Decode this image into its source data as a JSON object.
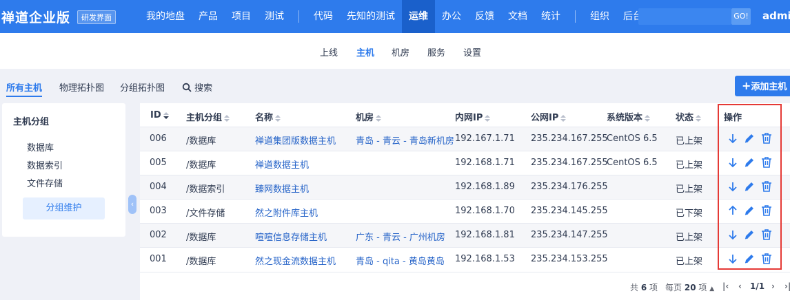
{
  "topbar": {
    "brand": "禅道企业版",
    "edition_badge": "研发界面",
    "nav": [
      "我的地盘",
      "产品",
      "项目",
      "测试",
      "代码",
      "先知的测试",
      "运维",
      "办公",
      "反馈",
      "文档",
      "统计",
      "组织",
      "后台"
    ],
    "active_nav": "运维",
    "go_label": "GO!",
    "user": "admin"
  },
  "subnav": {
    "items": [
      "上线",
      "主机",
      "机房",
      "服务",
      "设置"
    ],
    "active": "主机"
  },
  "toolbar": {
    "tabs": [
      "所有主机",
      "物理拓扑图",
      "分组拓扑图"
    ],
    "search_label": "搜索",
    "add_button": "添加主机"
  },
  "side": {
    "title": "主机分组",
    "items": [
      "数据库",
      "数据索引",
      "文件存储"
    ],
    "button": "分组维护"
  },
  "table": {
    "headers": [
      "ID",
      "主机分组",
      "名称",
      "机房",
      "内网IP",
      "公网IP",
      "系统版本",
      "状态",
      "操作"
    ],
    "rows": [
      {
        "id": "006",
        "group": "/数据库",
        "name": "禅道集团版数据主机",
        "room": "青岛 - 青云 - 青岛新机房",
        "intranet": "192.167.1.71",
        "public": "235.234.167.255",
        "os": "CentOS 6.5",
        "status": "已上架",
        "action": "down"
      },
      {
        "id": "005",
        "group": "/数据库",
        "name": "禅道数据主机",
        "room": "",
        "intranet": "192.168.1.71",
        "public": "235.234.167.255",
        "os": "CentOS 6.5",
        "status": "已上架",
        "action": "down"
      },
      {
        "id": "004",
        "group": "/数据索引",
        "name": "臻网数据主机",
        "room": "",
        "intranet": "192.168.1.89",
        "public": "235.234.176.255",
        "os": "",
        "status": "已上架",
        "action": "down"
      },
      {
        "id": "003",
        "group": "/文件存储",
        "name": "然之附件库主机",
        "room": "",
        "intranet": "192.168.1.70",
        "public": "235.234.145.255",
        "os": "",
        "status": "已下架",
        "action": "up"
      },
      {
        "id": "002",
        "group": "/数据库",
        "name": "喧喧信息存储主机",
        "room": "广东 - 青云 - 广州机房",
        "intranet": "192.168.1.81",
        "public": "235.234.147.255",
        "os": "",
        "status": "已上架",
        "action": "down"
      },
      {
        "id": "001",
        "group": "/数据库",
        "name": "然之现金流数据主机",
        "room": "青岛 - qita - 黄岛黄岛",
        "intranet": "192.168.1.53",
        "public": "235.234.153.255",
        "os": "",
        "status": "已上架",
        "action": "down"
      }
    ]
  },
  "pager": {
    "total_prefix": "共",
    "total": "6",
    "total_suffix": "项",
    "per_page_prefix": "每页",
    "per_page": "20",
    "per_page_suffix": "项",
    "page": "1/1"
  },
  "colors": {
    "primary": "#2e7bec",
    "link": "#2563c8",
    "highlight": "#e53935"
  }
}
